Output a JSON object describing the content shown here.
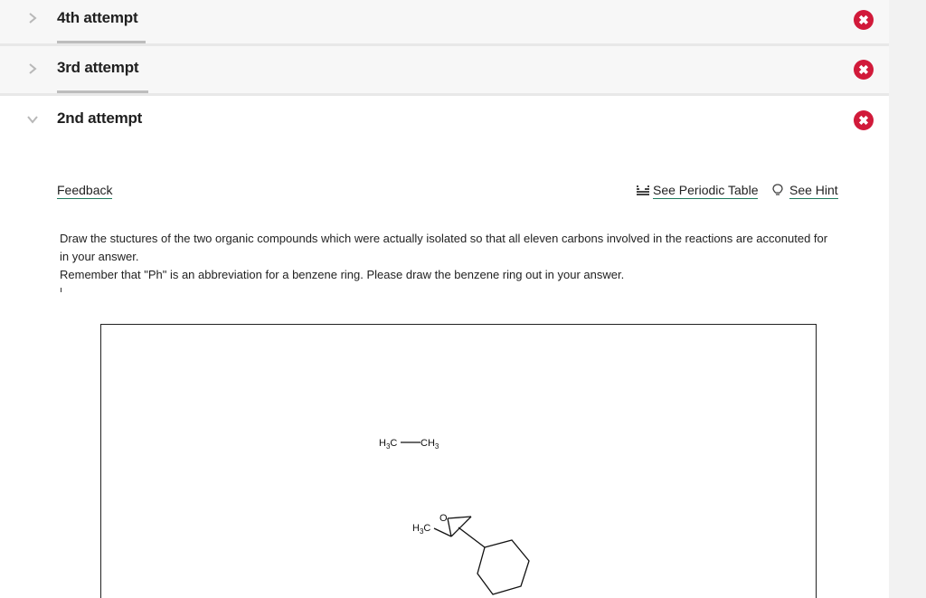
{
  "attempts": [
    {
      "label": "4th attempt",
      "state": "collapsed",
      "status": "incorrect",
      "chevron": "chevron-right-icon"
    },
    {
      "label": "3rd attempt",
      "state": "collapsed",
      "status": "incorrect",
      "chevron": "chevron-right-icon"
    },
    {
      "label": "2nd attempt",
      "state": "expanded",
      "status": "incorrect",
      "chevron": "chevron-down-icon"
    }
  ],
  "status_icon_glyph": "✖",
  "toolbar": {
    "feedback_label": "Feedback",
    "periodic_table_label": "See Periodic Table",
    "hint_label": "See Hint"
  },
  "question": {
    "line1": "Draw the stuctures of the two organic compounds which were actually isolated so that all eleven carbons involved in the reactions are acconuted for in your answer.",
    "line2": "Remember that \"Ph\" is an abbreviation for a benzene ring. Please draw the benzene ring out in your answer."
  },
  "molecules": {
    "ethane": {
      "left": "H3C",
      "right": "CH3"
    },
    "epoxide": {
      "oxygen": "O",
      "methyl": "H3C"
    }
  },
  "colors": {
    "incorrect_badge": "#d11a3a",
    "link_underline": "#1f7a5e",
    "row_background": "#f7f7f7"
  }
}
